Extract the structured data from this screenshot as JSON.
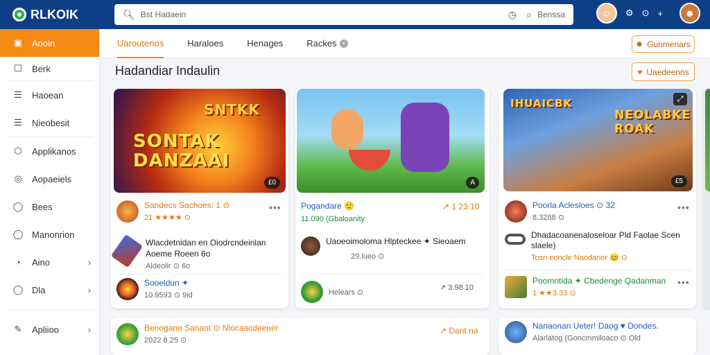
{
  "app": {
    "name": "RLKOIK"
  },
  "search": {
    "placeholder": "Bst Hadaein",
    "right_text": "Benssa"
  },
  "topbar": {
    "icons": [
      "clock-icon",
      "search-icon",
      "settings-icon",
      "add-icon"
    ],
    "symbols": [
      "⚙",
      "⊙",
      "+"
    ]
  },
  "sidebar": {
    "items": [
      {
        "label": "Aooin",
        "icon": "home-icon",
        "glyph": "▣"
      },
      {
        "label": "Berk",
        "icon": "bookmark-icon",
        "glyph": "☐"
      },
      {
        "label": "Haoean",
        "icon": "list-icon",
        "glyph": "☰"
      },
      {
        "label": "Nieobesit",
        "icon": "doc-icon",
        "glyph": "☰"
      },
      {
        "label": "Applikanos",
        "icon": "apps-icon",
        "glyph": "⬡"
      },
      {
        "label": "Aopaeiels",
        "icon": "gamepad-icon",
        "glyph": "◎"
      },
      {
        "label": "Bees",
        "icon": "circle-icon",
        "glyph": "◯"
      },
      {
        "label": "Manonrion",
        "icon": "user-icon",
        "glyph": "◯"
      },
      {
        "label": "Aino",
        "icon": "pin-icon",
        "glyph": "◔"
      },
      {
        "label": "Dla",
        "icon": "chat-icon",
        "glyph": "◯"
      },
      {
        "label": "Apliioo",
        "icon": "pencil-icon",
        "glyph": "✎"
      }
    ]
  },
  "tabs": [
    {
      "label": "Uaroutenos"
    },
    {
      "label": "Haraloes"
    },
    {
      "label": "Henages"
    },
    {
      "label": "Rackes"
    }
  ],
  "buttons": {
    "top": "Gunmenars",
    "second": "Uaedeenns"
  },
  "page": {
    "title": "Hadandiar Indaulin"
  },
  "cards": [
    {
      "title": "SONTAK DANZAAI",
      "title2": "SNTKK",
      "badge": "£0",
      "top_line1": "Sandecs Sachoes: 1 ⊘",
      "top_line2": "21 ★★★★ ⊙",
      "mid_line1": "Wlacdetnidan en Oiodrcndeinlan",
      "mid_line2": "Aoeme Roeen 6o",
      "mid_line3": "Aldeolir ⊙ 6o",
      "bottom_line1": "Sooeldun ✦",
      "bottom_line2": "10.9593 ⊙ 9id"
    },
    {
      "title": "",
      "badge": "A",
      "top_line1": "Pogandare 🙂",
      "top_line1_right": "↗ 1 23 10",
      "top_line2": "11.090 (Gbaloanity",
      "mid_line1": "Uaoeoimoloma Hlpteckee ✦ Sieoaem",
      "mid_line2": "29.lueo ⊙",
      "bottom_line1": "Helears ⊙",
      "bottom_right": "↗ 3.98 10"
    },
    {
      "title": "IHUAICBK",
      "title2": "NEOLABKE ROAK",
      "badge": "£5",
      "top_line1": "Poorla Aclesloes ⊙ 32",
      "top_line2": "8.3288 ⊙",
      "mid_line1": "Dhadacoanenaloseloar Pld Faolae Scen",
      "mid_line2": "slaele)",
      "mid_line3": "Tosn eoncle Naodanor 😊 ⊙",
      "bottom_line1": "Poomntida ✦ Cbedenge Qadanman",
      "bottom_line2": "1 ★★3.33 ⊙"
    }
  ],
  "lower_cards": [
    {
      "line1": "Benogane Sanant ⊙ Nlocaacdeener",
      "line2": "2022 8.25 ⊙",
      "right": "↗ Dant na"
    },
    {
      "line1": "Nanaonan Ueter! Daog ♥ Dondes.",
      "line2": "Alarlatog (Goncmmiloaco ⊙ Old"
    }
  ]
}
